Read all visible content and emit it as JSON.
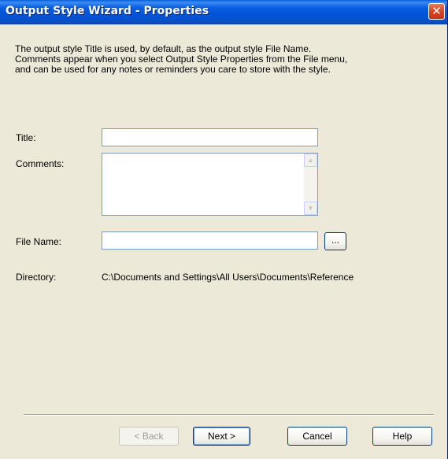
{
  "window": {
    "title": "Output Style Wizard - Properties",
    "close_glyph": "✕"
  },
  "intro": {
    "line1": "The output style Title is used, by default, as the output style File Name.",
    "line2": "Comments appear when you select Output Style Properties from the File menu,",
    "line3": "and can be used for any notes or reminders you care to store with the style."
  },
  "form": {
    "title_label": "Title:",
    "title_value": "",
    "comments_label": "Comments:",
    "comments_value": "",
    "filename_label": "File Name:",
    "filename_value": "",
    "browse_label": "...",
    "directory_label": "Directory:",
    "directory_value": "C:\\Documents and Settings\\All Users\\Documents\\Reference"
  },
  "buttons": {
    "back": "< Back",
    "next": "Next >",
    "cancel": "Cancel",
    "help": "Help"
  },
  "icons": {
    "scroll_up": "▲",
    "scroll_down": "▼"
  },
  "colors": {
    "titlebar": "#0254d6",
    "dialog_bg": "#ece9d8",
    "close_button": "#d4441f",
    "field_border": "#7f9db9"
  }
}
